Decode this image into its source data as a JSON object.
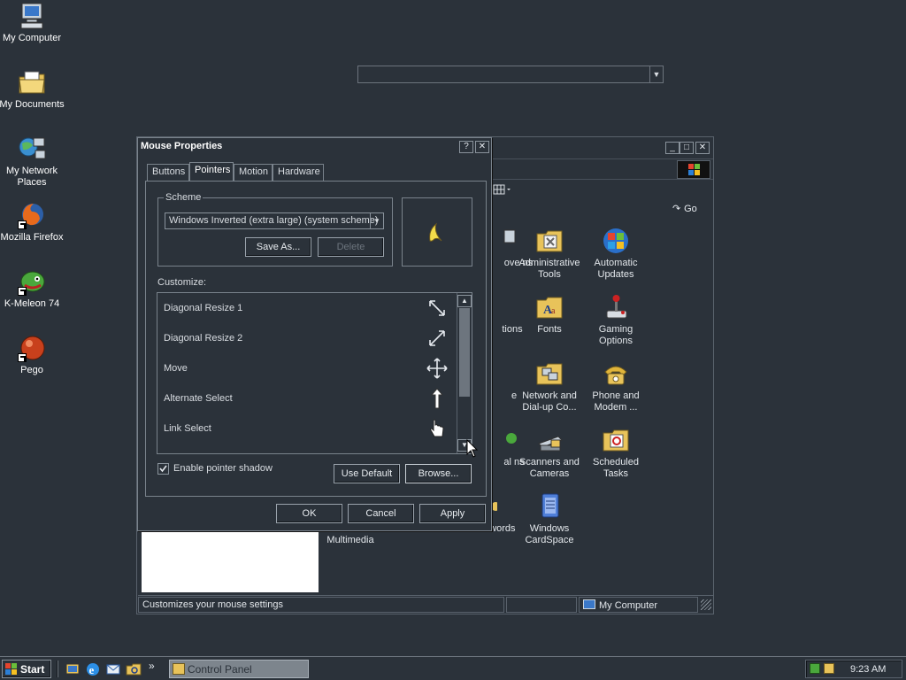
{
  "desktop": {
    "icons": [
      {
        "label": "My Computer"
      },
      {
        "label": "My Documents"
      },
      {
        "label": "My Network Places"
      },
      {
        "label": "Mozilla Firefox"
      },
      {
        "label": "K-Meleon 74"
      },
      {
        "label": "Pego"
      }
    ]
  },
  "control_panel": {
    "address_go": "Go",
    "items": [
      {
        "label": "ove ns"
      },
      {
        "label": "Administrative Tools"
      },
      {
        "label": "Automatic Updates"
      },
      {
        "label": "tions"
      },
      {
        "label": "Fonts"
      },
      {
        "label": "Gaming Options"
      },
      {
        "label": "e"
      },
      {
        "label": "Network and Dial-up Co..."
      },
      {
        "label": "Phone and Modem ..."
      },
      {
        "label": "al ns"
      },
      {
        "label": "Scanners and Cameras"
      },
      {
        "label": "Scheduled Tasks"
      },
      {
        "label": "Multimedia"
      },
      {
        "label": "nd Passwords"
      },
      {
        "label": "Windows CardSpace"
      }
    ],
    "status": {
      "text": "Customizes your mouse settings",
      "zone": "My Computer"
    }
  },
  "dialog": {
    "title": "Mouse Properties",
    "help_button": "?",
    "close_button": "✕",
    "tabs": [
      "Buttons",
      "Pointers",
      "Motion",
      "Hardware"
    ],
    "active_tab": "Pointers",
    "scheme_label": "Scheme",
    "scheme_value": "Windows Inverted (extra large) (system scheme)",
    "save_as": "Save As...",
    "delete": "Delete",
    "customize_label": "Customize:",
    "pointers": [
      {
        "label": "Diagonal Resize 1",
        "icon": "diagonal-resize-1-icon"
      },
      {
        "label": "Diagonal Resize 2",
        "icon": "diagonal-resize-2-icon"
      },
      {
        "label": "Move",
        "icon": "move-icon"
      },
      {
        "label": "Alternate Select",
        "icon": "alternate-select-icon"
      },
      {
        "label": "Link Select",
        "icon": "link-select-icon"
      }
    ],
    "enable_shadow_label": "Enable pointer shadow",
    "enable_shadow_checked": true,
    "use_default": "Use Default",
    "browse": "Browse...",
    "ok": "OK",
    "cancel": "Cancel",
    "apply": "Apply"
  },
  "taskbar": {
    "start": "Start",
    "task": "Control Panel",
    "clock": "9:23 AM",
    "quicklaunch_more": "»"
  }
}
